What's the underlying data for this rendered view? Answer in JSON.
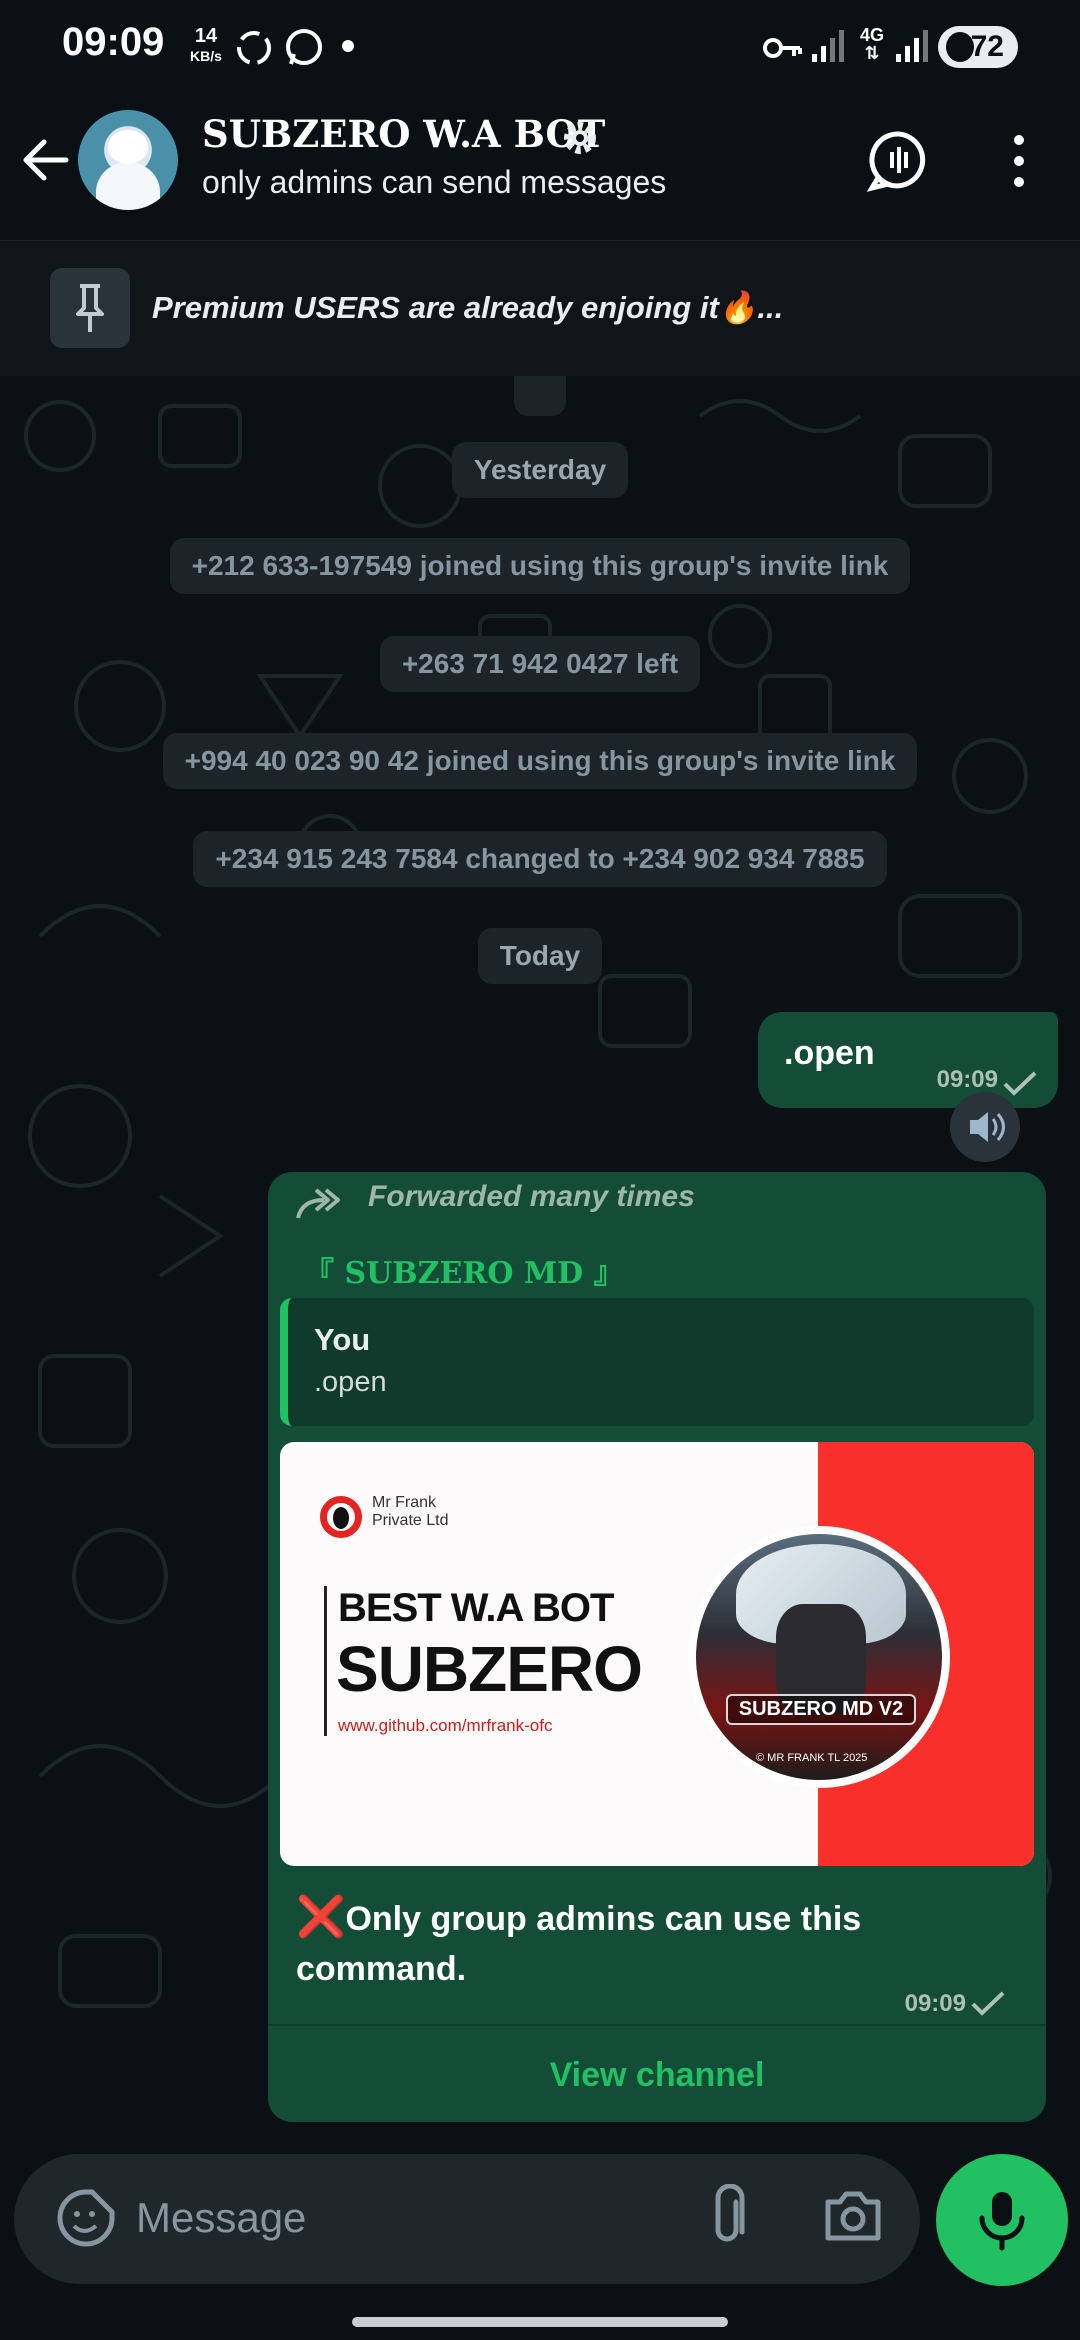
{
  "status_bar": {
    "time": "09:09",
    "speed_value": "14",
    "speed_unit": "KB/s",
    "network": "4G",
    "battery": "72"
  },
  "header": {
    "title": "SUBZERO W.A BOT",
    "subtitle": "only admins can send messages"
  },
  "pinned": {
    "text": "Premium USERS are already enjoing it🔥..."
  },
  "system_messages": {
    "date_yesterday": "Yesterday",
    "event1": "+212 633-197549 joined using this group's invite link",
    "event2": "+263 71 942 0427 left",
    "event3": "+994 40 023 90 42 joined using this group's invite link",
    "event4": "+234 915 243 7584 changed to +234 902 934 7885",
    "date_today": "Today"
  },
  "outgoing_message": {
    "text": ".open",
    "time": "09:09"
  },
  "forwarded_card": {
    "forwarded_label": "Forwarded many times",
    "channel_name": "『 SUBZERO MD 』",
    "quote_sender": "You",
    "quote_text": ".open",
    "banner": {
      "company_line1": "Mr Frank",
      "company_line2": "Private Ltd",
      "line1": "BEST W.A BOT",
      "line2": "SUBZERO",
      "url": "www.github.com/mrfrank-ofc",
      "badge": "SUBZERO MD V2",
      "copyright": "© MR FRANK TL 2025"
    },
    "error_icon": "❌",
    "message": "Only group admins can use this command.",
    "time": "09:09",
    "action": "View channel"
  },
  "composer": {
    "placeholder": "Message"
  },
  "colors": {
    "background": "#0b1014",
    "bubble_outgoing": "#144d37",
    "accent": "#21c063"
  }
}
